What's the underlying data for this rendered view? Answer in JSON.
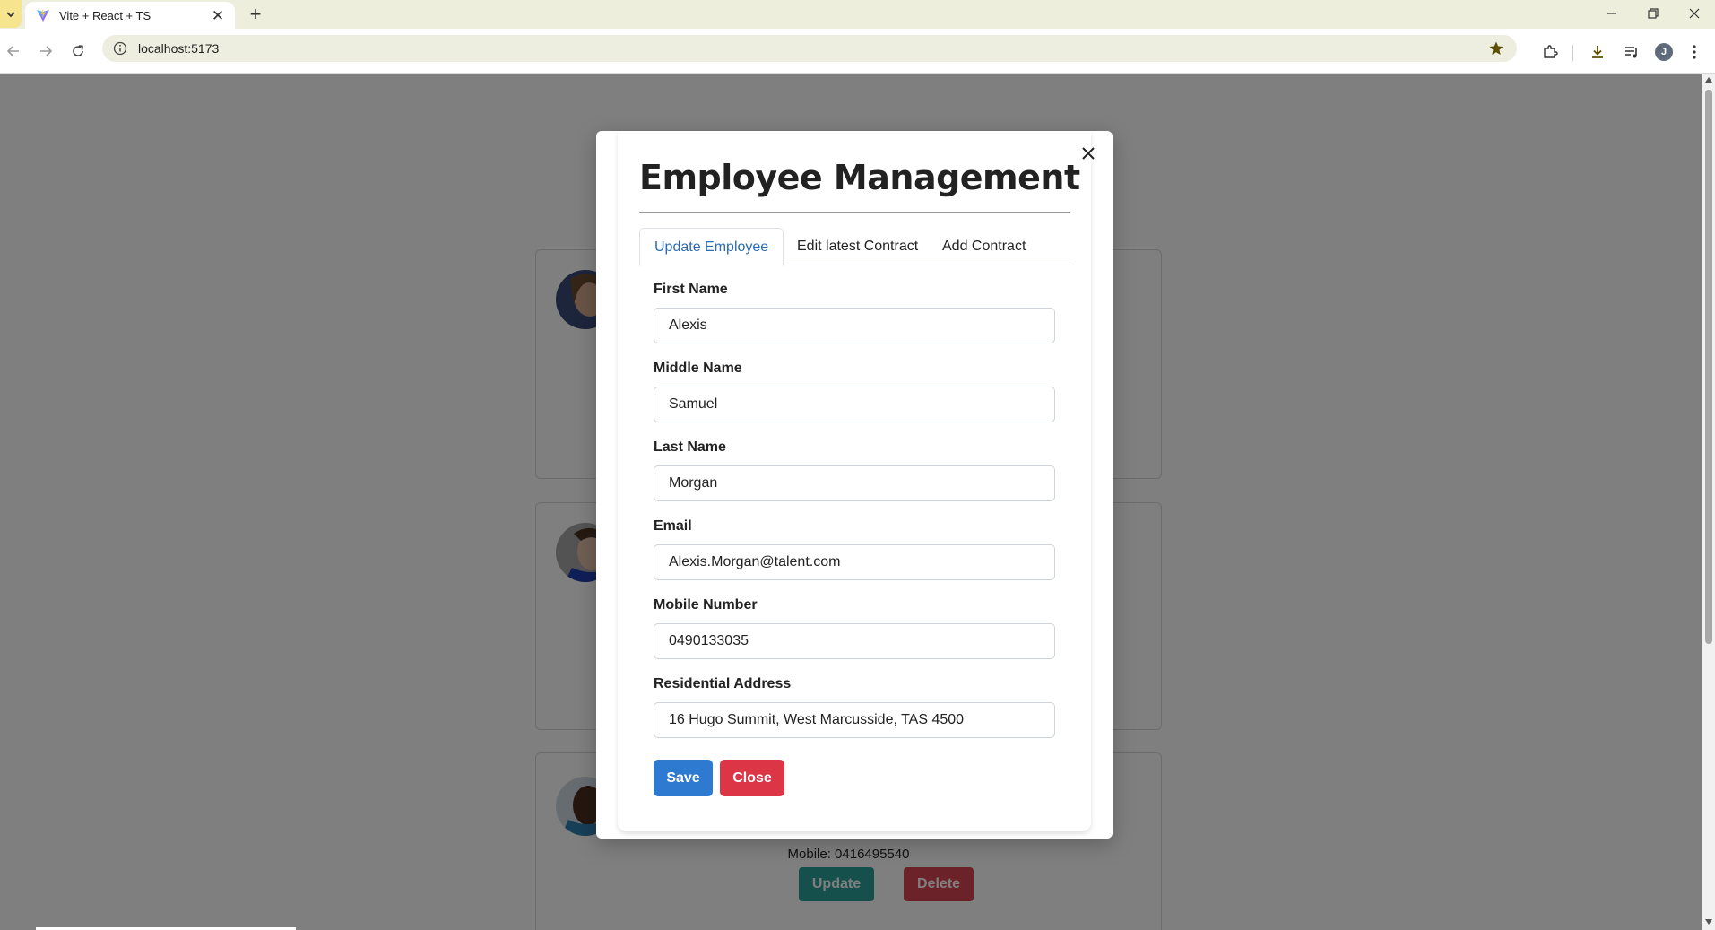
{
  "browser": {
    "tab_title": "Vite + React + TS",
    "url": "localhost:5173",
    "profile_initial": "J"
  },
  "colors": {
    "primary": "#2d7ad0",
    "danger": "#dc3545",
    "teal": "#2aa198",
    "tab_active": "#2b6cb0"
  },
  "background_cards": [
    {
      "lines": []
    },
    {
      "lines": []
    },
    {
      "mobile_label": "Mobile: 0416495540",
      "update_label": "Update",
      "delete_label": "Delete"
    }
  ],
  "modal": {
    "title": "Employee Management",
    "tabs": [
      {
        "label": "Update Employee",
        "active": true
      },
      {
        "label": "Edit latest Contract",
        "active": false
      },
      {
        "label": "Add Contract",
        "active": false
      }
    ],
    "fields": [
      {
        "label": "First Name",
        "value": "Alexis"
      },
      {
        "label": "Middle Name",
        "value": "Samuel"
      },
      {
        "label": "Last Name",
        "value": "Morgan"
      },
      {
        "label": "Email",
        "value": "Alexis.Morgan@talent.com"
      },
      {
        "label": "Mobile Number",
        "value": "0490133035"
      },
      {
        "label": "Residential Address",
        "value": "16 Hugo Summit, West Marcusside, TAS 4500"
      }
    ],
    "save_label": "Save",
    "close_label": "Close"
  },
  "icons": {
    "tab_menu": "chevron-down-icon",
    "favicon": "vite-logo-icon",
    "back": "arrow-left-icon",
    "forward": "arrow-right-icon",
    "reload": "reload-icon",
    "site_info": "info-icon",
    "bookmark": "star-icon",
    "extensions": "puzzle-icon",
    "downloads": "download-icon",
    "media": "media-queue-icon",
    "menu": "kebab-menu-icon",
    "modal_close": "close-icon"
  }
}
